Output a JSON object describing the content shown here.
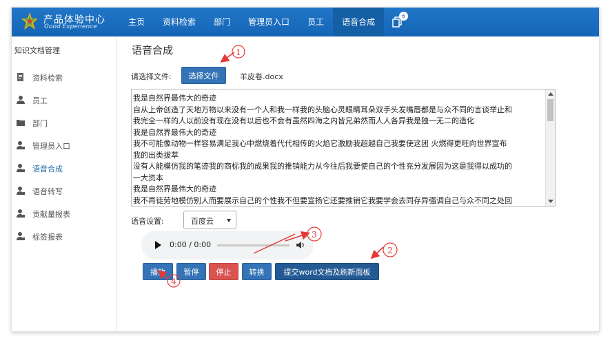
{
  "brand": {
    "title": "产品体验中心",
    "subtitle": "Good Experience"
  },
  "nav": {
    "items": [
      {
        "label": "主页"
      },
      {
        "label": "资料检索"
      },
      {
        "label": "部门"
      },
      {
        "label": "管理员入口"
      },
      {
        "label": "员工"
      },
      {
        "label": "语音合成"
      }
    ],
    "notification_count": "6"
  },
  "sidebar": {
    "title": "知识文档管理",
    "items": [
      {
        "label": "资料检索",
        "icon": "document-icon"
      },
      {
        "label": "员工",
        "icon": "user-icon"
      },
      {
        "label": "部门",
        "icon": "folder-icon"
      },
      {
        "label": "管理员入口",
        "icon": "user-tie-icon"
      },
      {
        "label": "语音合成",
        "icon": "user-tie-icon"
      },
      {
        "label": "语音转写",
        "icon": "user-tie-icon"
      },
      {
        "label": "贡献量报表",
        "icon": "user-tie-icon"
      },
      {
        "label": "标签报表",
        "icon": "user-tie-icon"
      }
    ]
  },
  "main": {
    "title": "语音合成",
    "file_label": "请选择文件:",
    "choose_file_button": "选择文件",
    "file_name": "羊皮卷.docx",
    "text_content": "我是自然界最伟大的奇迹\n自从上帝创造了天地万物以来没有一个人和我一样我的头脑心灵眼睛耳朵双手头发嘴唇都是与众不同的言谈举止和\n我完全一样的人以前没有现在没有以后也不会有虽然四海之内皆兄弟然而人人各异我是独一无二的造化\n我是自然界最伟大的奇迹\n我不可能像动物一样容易满足我心中燃烧着代代相传的火焰它激励我超越自己我要使这团 火燃得更旺向世界宣布\n我的出类拔萃\n没有人能模仿我的笔迹我的商标我的成果我的推销能力从今往后我要使自己的个性充分发展因为这是我得以成功的\n一大资本\n我是自然界最伟大的奇迹\n我不再徒劳地模仿别人而要展示自己的个性我不但要宣扬它还要推销它我要学会去同存异强调自己与众不同之处回",
    "voice_label": "语音设置:",
    "voice_option": "百度云",
    "audio_time": "0:00 / 0:00",
    "buttons": {
      "play": "播放",
      "pause": "暂停",
      "stop": "停止",
      "convert": "转换",
      "submit": "提交word文档及刷新面板"
    }
  },
  "annotations": {
    "n1": "1",
    "n2": "2",
    "n3": "3",
    "n4": "4",
    "color": "#e53935"
  }
}
